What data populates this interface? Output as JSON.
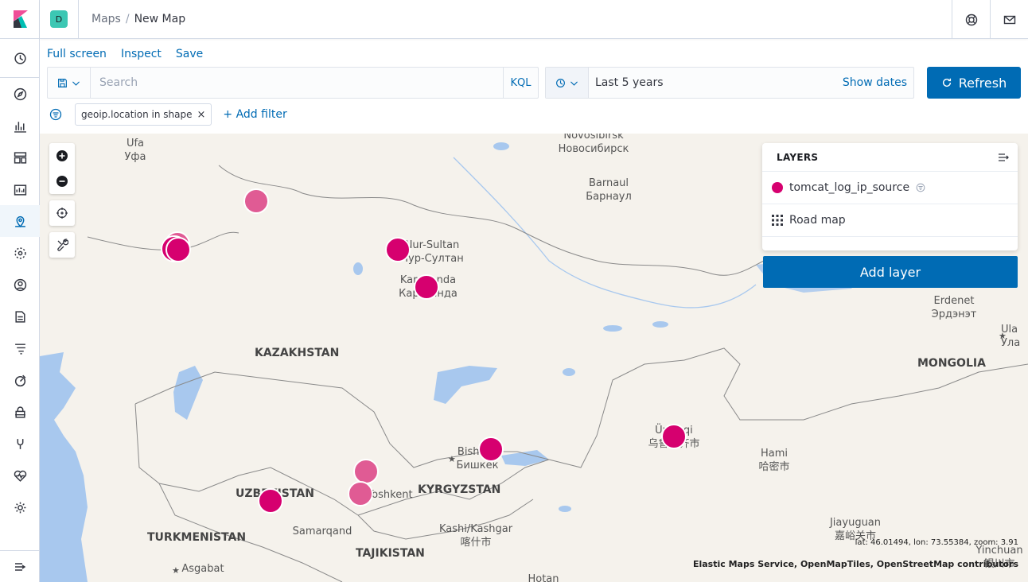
{
  "header": {
    "space_initial": "D",
    "breadcrumbs": [
      "Maps",
      "New Map"
    ],
    "breadcrumb_sep": "/"
  },
  "top_menu": [
    "Full screen",
    "Inspect",
    "Save"
  ],
  "query": {
    "placeholder": "Search",
    "language": "KQL"
  },
  "date": {
    "value": "Last 5 years",
    "show_dates": "Show dates"
  },
  "refresh_label": "Refresh",
  "filters": {
    "pills": [
      {
        "label": "geoip.location in shape",
        "close": "×"
      }
    ],
    "add_label": "+ Add filter"
  },
  "layers": {
    "title": "LAYERS",
    "items": [
      {
        "name": "tomcat_log_ip_source",
        "color": "#d6006f",
        "icon": "circle-dot-icon"
      },
      {
        "name": "Road map",
        "icon": "grid-icon"
      }
    ],
    "add_label": "Add layer"
  },
  "map": {
    "places": [
      {
        "id": "ufa",
        "text": [
          "Ufa",
          "Уфа"
        ]
      },
      {
        "id": "novosibirsk",
        "text": [
          "Novosibirsk",
          "Новосибирск"
        ]
      },
      {
        "id": "barnaul",
        "text": [
          "Barnaul",
          "Барнаул"
        ]
      },
      {
        "id": "nursultan",
        "text": [
          "Nur-Sultan",
          "Нур-Султан"
        ]
      },
      {
        "id": "karaganda",
        "text": [
          "Karaganda",
          "Караганда"
        ]
      },
      {
        "id": "erdenet",
        "text": [
          "Erdenet",
          "Эрдэнэт"
        ]
      },
      {
        "id": "ula",
        "text": [
          "Ula",
          "Ула"
        ]
      },
      {
        "id": "bishkek",
        "text": [
          "Bishkek",
          "Бишкек"
        ]
      },
      {
        "id": "urumqi",
        "text": [
          "Ürümqi",
          "乌鲁木齐市"
        ]
      },
      {
        "id": "hami",
        "text": [
          "Hami",
          "哈密市"
        ]
      },
      {
        "id": "toshkent",
        "text": [
          "Toshkent"
        ]
      },
      {
        "id": "samarqand",
        "text": [
          "Samarqand"
        ]
      },
      {
        "id": "kashi",
        "text": [
          "Kashi/Kashgar",
          "喀什市"
        ]
      },
      {
        "id": "jiayuguan",
        "text": [
          "Jiayuguan",
          "嘉峪关市"
        ]
      },
      {
        "id": "asgabat",
        "text": [
          "Asgabat"
        ]
      },
      {
        "id": "yinchuan",
        "text": [
          "Yinchuan",
          "银川市"
        ]
      },
      {
        "id": "hotan",
        "text": [
          "Hotan"
        ]
      }
    ],
    "countries": [
      "KAZAKHSTAN",
      "MONGOLIA",
      "UZBEKISTAN",
      "KYRGYZSTAN",
      "TURKMENISTAN",
      "TAJIKISTAN"
    ],
    "coords": "lat: 46.01494, lon: 73.55384, zoom: 3.91",
    "attribution": "Elastic Maps Service, OpenMapTiles, OpenStreetMap contributors"
  },
  "colors": {
    "accent": "#006bb4",
    "point": "#d6006f",
    "water": "#a8c8ee",
    "land": "#f5f2ec"
  }
}
